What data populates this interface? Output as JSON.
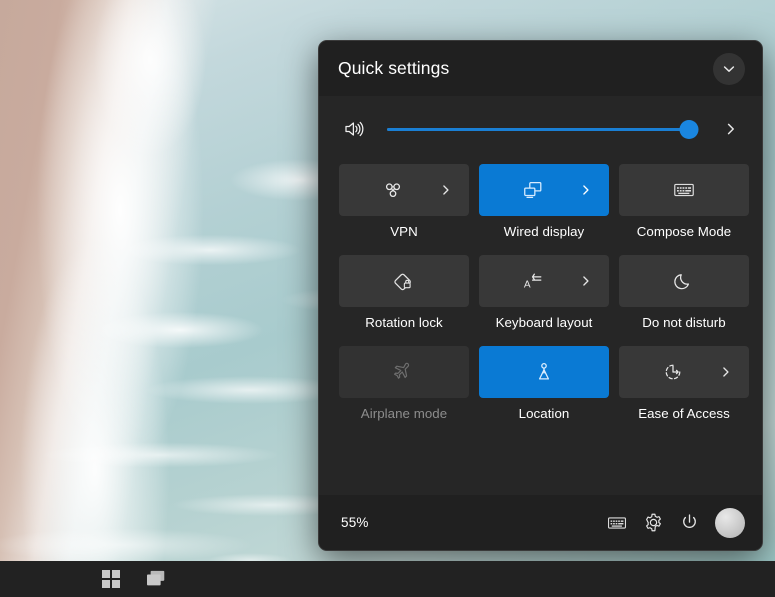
{
  "flyout": {
    "title": "Quick settings",
    "collapse_icon": "chevron-down-icon",
    "volume": {
      "icon": "volume-high-icon",
      "value": 97,
      "expand_icon": "chevron-right-icon"
    },
    "tiles": [
      {
        "label": "VPN",
        "icon": "vpn-icon",
        "state": "off",
        "has_arrow": true
      },
      {
        "label": "Wired display",
        "icon": "wired-display-icon",
        "state": "on",
        "has_arrow": true
      },
      {
        "label": "Compose Mode",
        "icon": "keyboard-icon",
        "state": "off",
        "has_arrow": false
      },
      {
        "label": "Rotation lock",
        "icon": "rotation-lock-icon",
        "state": "off",
        "has_arrow": false
      },
      {
        "label": "Keyboard layout",
        "icon": "keyboard-layout-icon",
        "state": "off",
        "has_arrow": true
      },
      {
        "label": "Do not disturb",
        "icon": "moon-icon",
        "state": "off",
        "has_arrow": false
      },
      {
        "label": "Airplane mode",
        "icon": "airplane-icon",
        "state": "disabled",
        "has_arrow": false
      },
      {
        "label": "Location",
        "icon": "location-icon",
        "state": "on",
        "has_arrow": false
      },
      {
        "label": "Ease of Access",
        "icon": "ease-of-access-icon",
        "state": "off",
        "has_arrow": true
      }
    ],
    "footer": {
      "battery": "55%",
      "buttons": [
        {
          "icon": "keyboard-icon"
        },
        {
          "icon": "gear-icon"
        },
        {
          "icon": "power-icon"
        }
      ],
      "avatar": "user-avatar"
    }
  },
  "taskbar": {
    "buttons": [
      {
        "icon": "windows-start-icon"
      },
      {
        "icon": "task-view-icon"
      }
    ]
  },
  "colors": {
    "accent": "#0a7ad4",
    "slider": "#1a7fd4",
    "panel": "#262626",
    "panel_bar": "#202020",
    "tile": "#383838",
    "taskbar": "#222222"
  }
}
